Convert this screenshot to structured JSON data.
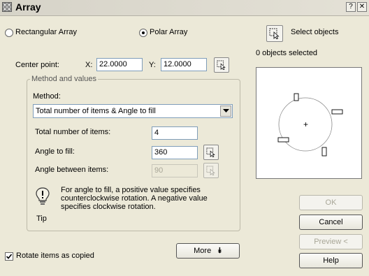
{
  "window": {
    "title": "Array",
    "help_label": "?",
    "close_label": "✕"
  },
  "array_type": {
    "rectangular_label": "Rectangular Array",
    "polar_label": "Polar Array",
    "selected": "polar"
  },
  "selection": {
    "button_label": "Select objects",
    "count_text": "0 objects selected"
  },
  "center_point": {
    "label": "Center point:",
    "x_label": "X:",
    "x_value": "22.0000",
    "y_label": "Y:",
    "y_value": "12.0000"
  },
  "method_group": {
    "legend": "Method and values",
    "method_label": "Method:",
    "method_value": "Total number of items & Angle to fill",
    "items_label": "Total number of items:",
    "items_value": "4",
    "angle_label": "Angle to fill:",
    "angle_value": "360",
    "between_label": "Angle between items:",
    "between_value": "90",
    "tip_title": "Tip",
    "tip_text": "For angle to fill, a positive value specifies counterclockwise rotation.  A negative value specifies clockwise rotation."
  },
  "rotate": {
    "label": "Rotate items as copied",
    "checked": true
  },
  "more_button": {
    "label": "More",
    "arrow": "¥"
  },
  "buttons": {
    "ok": "OK",
    "cancel": "Cancel",
    "preview": "Preview <",
    "help": "Help"
  },
  "icons": {
    "pick": "pick-point-icon",
    "tip": "lightbulb-icon",
    "app": "array-icon"
  }
}
